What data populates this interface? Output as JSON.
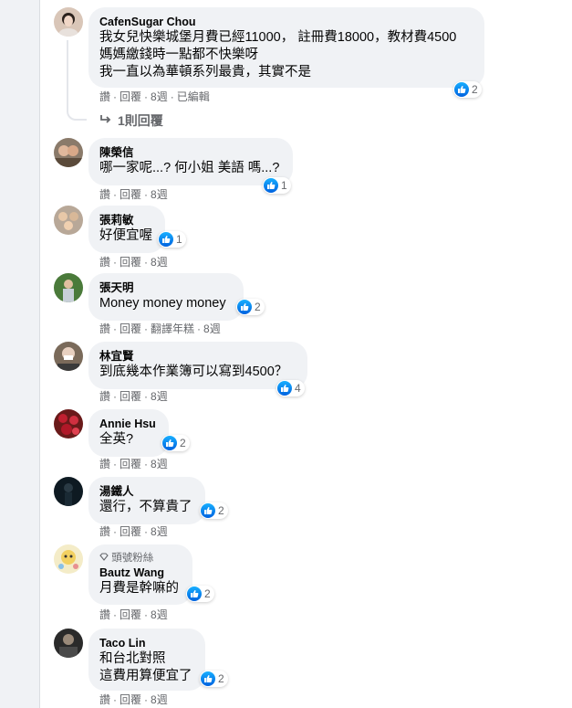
{
  "comments": [
    {
      "author": "CafenSugar Chou",
      "lines": [
        "我女兒快樂城堡月費已經11000， 註冊費18000，教材費4500",
        "媽媽繳錢時一點都不快樂呀",
        "我一直以為華頓系列最貴，其實不是"
      ],
      "actions": [
        "讚",
        "回覆",
        "8週",
        "已編輯"
      ],
      "reactions": "2"
    },
    {
      "author": "陳榮信",
      "lines": [
        "哪一家呢...? 何小姐 美語 嗎...?"
      ],
      "actions": [
        "讚",
        "回覆",
        "8週"
      ],
      "reactions": "1"
    },
    {
      "author": "張莉敏",
      "lines": [
        "好便宜喔"
      ],
      "actions": [
        "讚",
        "回覆",
        "8週"
      ],
      "reactions": "1"
    },
    {
      "author": "張天明",
      "lines": [
        "Money money money"
      ],
      "actions": [
        "讚",
        "回覆",
        "翻譯年糕",
        "8週"
      ],
      "reactions": "2"
    },
    {
      "author": "林宜賢",
      "lines": [
        "到底幾本作業簿可以寫到4500？"
      ],
      "actions": [
        "讚",
        "回覆",
        "8週"
      ],
      "reactions": "4"
    },
    {
      "author": "Annie Hsu",
      "lines": [
        "全英?"
      ],
      "actions": [
        "讚",
        "回覆",
        "8週"
      ],
      "reactions": "2"
    },
    {
      "author": "湯鐵人",
      "lines": [
        "還行，不算貴了"
      ],
      "actions": [
        "讚",
        "回覆",
        "8週"
      ],
      "reactions": "2"
    },
    {
      "author": "Bautz Wang",
      "badge": "頭號粉絲",
      "lines": [
        "月費是幹嘛的"
      ],
      "actions": [
        "讚",
        "回覆",
        "8週"
      ],
      "reactions": "2"
    },
    {
      "author": "Taco Lin",
      "lines": [
        "和台北對照",
        "這費用算便宜了"
      ],
      "actions": [
        "讚",
        "回覆",
        "8週"
      ],
      "reactions": "2"
    }
  ],
  "reply_link": "1則回覆",
  "colors": {
    "like_blue": "#1877f2",
    "bubble": "#f0f2f5",
    "meta": "#65676b"
  },
  "icons": [
    "like-icon",
    "reply-arrow-icon",
    "diamond-icon"
  ]
}
